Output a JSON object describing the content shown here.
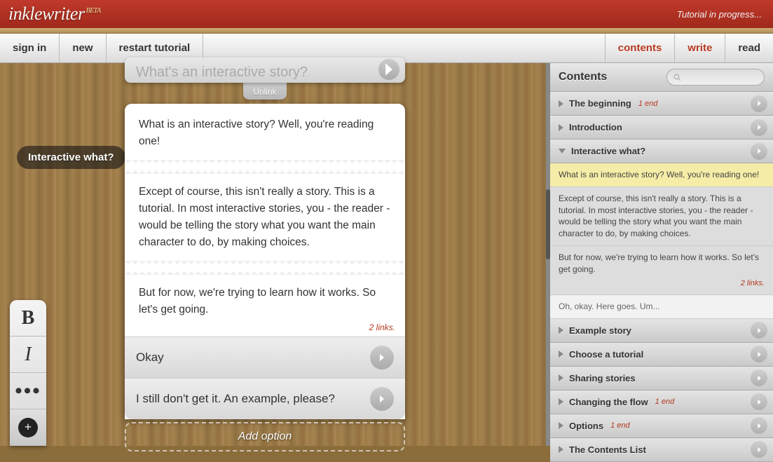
{
  "header": {
    "logo_main": "inklewriter",
    "logo_beta": "BETA",
    "status": "Tutorial in progress..."
  },
  "menu": {
    "left": {
      "signin": "sign in",
      "new": "new",
      "restart": "restart tutorial"
    },
    "right": {
      "contents": "contents",
      "write": "write",
      "read": "read"
    }
  },
  "section_label": "Interactive what?",
  "story": {
    "prev_truncated": "What's an interactive story?",
    "unlink": "Unlink",
    "p1": "  What is an interactive story? Well, you're reading one!",
    "p2": "  Except of course, this isn't really a story. This is a tutorial. In most interactive stories, you - the reader - would be telling the story what you want the main character to do, by making choices.",
    "p3": "  But for now, we're trying to learn how it works. So let's get going.",
    "links_note": "2 links.",
    "opt1": "Okay",
    "opt2": "I still don't get it. An example, please?",
    "add_option": "Add option"
  },
  "fmt": {
    "bold": "B",
    "italic": "I",
    "more": "•••",
    "plus": "+"
  },
  "sidebar": {
    "title": "Contents",
    "items": [
      {
        "label": "The beginning",
        "meta": "1 end"
      },
      {
        "label": "Introduction",
        "meta": ""
      },
      {
        "label": "Interactive what?",
        "meta": "",
        "expanded": true
      },
      {
        "label": "Example story",
        "meta": ""
      },
      {
        "label": "Choose a tutorial",
        "meta": ""
      },
      {
        "label": "Sharing stories",
        "meta": ""
      },
      {
        "label": "Changing the flow",
        "meta": "1 end"
      },
      {
        "label": "Options",
        "meta": "1 end"
      },
      {
        "label": "The Contents List",
        "meta": ""
      }
    ],
    "expanded": {
      "p1": "What is an interactive story? Well, you're reading one!",
      "p2": "Except of course, this isn't really a story. This is a tutorial. In most interactive stories, you - the reader - would be telling the story what you want the main character to do, by making choices.",
      "p3": "But for now, we're trying to learn how it works. So let's get going.",
      "links_note": "2 links.",
      "tail": "Oh, okay. Here goes. Um..."
    }
  }
}
